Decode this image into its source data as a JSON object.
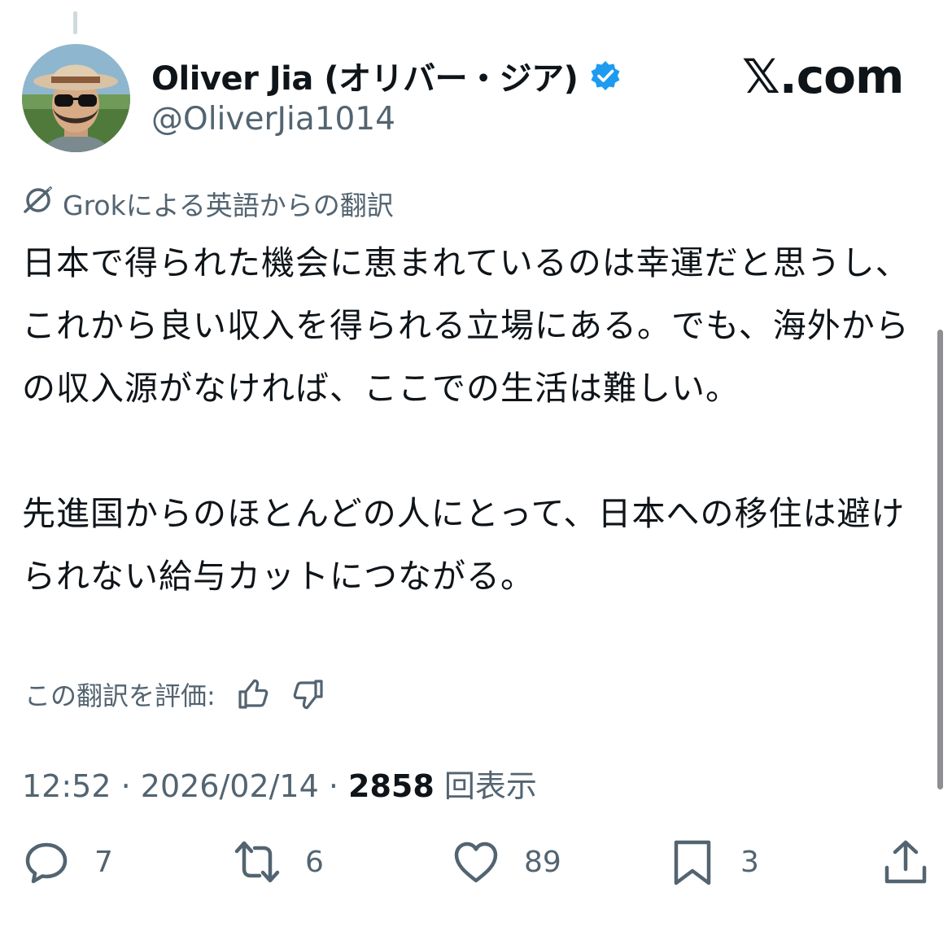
{
  "author": {
    "display_name": "Oliver Jia (オリバー・ジア)",
    "handle": "@OliverJia1014",
    "verified_color": "#1d9bf0"
  },
  "brand": {
    "logo_text": "𝕏.com"
  },
  "translation": {
    "note": "Grokによる英語からの翻訳",
    "icon": "grok-icon"
  },
  "tweet": {
    "text": "日本で得られた機会に恵まれているのは幸運だと思うし、これから良い収入を得られる立場にある。でも、海外からの収入源がなければ、ここでの生活は難しい。\n\n先進国からのほとんどの人にとって、日本への移住は避けられない給与カットにつながる。"
  },
  "rating": {
    "label": "この翻訳を評価:",
    "icons": [
      "thumbs-up-icon",
      "thumbs-down-icon"
    ]
  },
  "meta": {
    "time": "12:52",
    "sep1": " · ",
    "date": "2026/02/14",
    "sep2": " · ",
    "views_count": "2858",
    "views_label": " 回表示"
  },
  "actions": {
    "replies": "7",
    "reposts": "6",
    "likes": "89",
    "bookmarks": "3"
  }
}
